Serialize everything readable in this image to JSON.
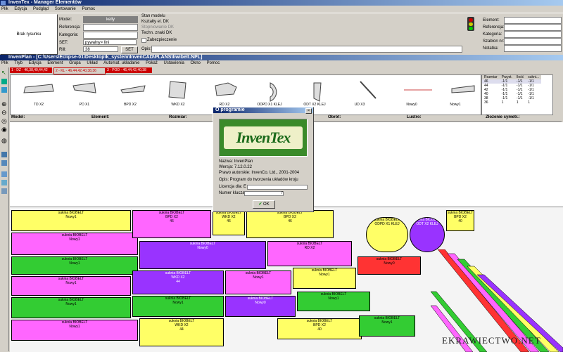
{
  "manager": {
    "title": "InvenTex - Manager Elementów",
    "menu": [
      "Plik",
      "Edycja",
      "Podgląd",
      "Sortowanie",
      "Pomoc"
    ],
    "preview_button": "Brak rysunku",
    "labels": {
      "model": "Model:",
      "referencja": "Referencja:",
      "kategoria": "Kategoria:",
      "set": "SET:",
      "rill": "Rill:"
    },
    "model_value": "kelly",
    "set_value": "pywalny> lini",
    "rill_value": "38",
    "set_button": "SET",
    "stan_title": "Stan modelu",
    "stan_lines": [
      "Kształty el. DK",
      "Stopniowanie DK",
      "Techn. znaki DK"
    ],
    "zabezpieczenie": "Zabezpieczenie",
    "opis": "Opis:",
    "right_labels": [
      "Element:",
      "Referencja:",
      "Kategoria:",
      "Szablon nr:",
      "Notatka:"
    ]
  },
  "plan": {
    "title": "InvenPlan - [C:\\Users\\Eclipse-01\\Desktop\\k_system\\InvenCAD\\PLANS\\liwibelt.NPL]",
    "menu": [
      "Plik",
      "Tryb",
      "Edycja",
      "Element",
      "Grupa",
      "Układ",
      "Automat. układanie",
      "Pokaż",
      "Ustawienia",
      "Okno",
      "Pomoc"
    ],
    "tabs": [
      "1 - DZ - 46,38,40,44,42",
      "2 - KL - 46,44,42,40,38,36",
      "3 - POD - 46,44,42,40,38"
    ],
    "shapes": [
      {
        "label": "TD X2"
      },
      {
        "label": "PD X1"
      },
      {
        "label": "BPD X2"
      },
      {
        "label": "WKD X2"
      },
      {
        "label": "RD X2"
      },
      {
        "label": "ODPD X1 KLEJ"
      },
      {
        "label": "ODT X2 KLEJ"
      },
      {
        "label": "UD X3"
      },
      {
        "label": "Nowy0"
      },
      {
        "label": "Nowy1"
      }
    ],
    "size_table": {
      "headers": [
        "Rozmiar",
        "Przyst.",
        "Ilość",
        "sukni..."
      ],
      "rows": [
        [
          "46",
          "-1/1",
          "-1/1",
          "-1/1"
        ],
        [
          "44",
          "-1/1",
          "-1/1",
          "-1/1"
        ],
        [
          "42",
          "-1/1",
          "-1/1",
          "-1/1"
        ],
        [
          "40",
          "-1/1",
          "-1/1",
          "-1/1"
        ],
        [
          "38",
          "-1/1",
          "-1/1",
          "-1/1"
        ],
        [
          "36",
          "1",
          "1",
          "1"
        ]
      ]
    },
    "columns": [
      "Model:",
      "Element:",
      "Rozmiar:",
      "Obrót:",
      "Lustro:",
      "Złożenie symetr.:"
    ],
    "pieces": [
      {
        "text": "suknia BIOBELT\nNowy1",
        "color": "#ffff66"
      },
      {
        "text": "suknia BIOBELT\nNowy1",
        "color": "#ff66ff"
      },
      {
        "text": "suknia BIOBELT\nBPD X2\n46",
        "color": "#ff66ff"
      },
      {
        "text": "suknia BIOBELT\nWKD X2\n46",
        "color": "#ffff66"
      },
      {
        "text": "suknia BIOBELT\nBPD X2\n46",
        "color": "#ffff66"
      },
      {
        "text": "suknia BIOBELT\nNowy1",
        "color": "#33cc33"
      },
      {
        "text": "suknia BIOBELT\nNowy0",
        "color": "#9933ff"
      },
      {
        "text": "suknia BIOBELT\nRD X2",
        "color": "#ff66ff"
      },
      {
        "text": "suknia BIOBELT\nNowy1",
        "color": "#ff66ff"
      },
      {
        "text": "suknia BIOBELT\nNowy1",
        "color": "#33cc33"
      },
      {
        "text": "suknia BIOBELT\nWKD X2\n44",
        "color": "#9933ff"
      },
      {
        "text": "suknia BIOBELT\nNowy1",
        "color": "#ff66ff"
      },
      {
        "text": "suknia BIOBELT\nNowy1",
        "color": "#ffff66"
      },
      {
        "text": "suknia BIOBELT\nNowy1",
        "color": "#ff66ff"
      },
      {
        "text": "suknia BIOBELT\nNowy1",
        "color": "#33cc33"
      },
      {
        "text": "suknia BIOBELT\nNowy0",
        "color": "#9933ff"
      },
      {
        "text": "suknia BIOBELT\nNowy1",
        "color": "#33cc33"
      },
      {
        "text": "suknia BIOBELT\nWKD X2\n44",
        "color": "#ffff66"
      },
      {
        "text": "suknia BIOBELT\nBPD X2\n40",
        "color": "#ffff66"
      },
      {
        "text": "suknia BIOBELT\nNowy1",
        "color": "#33cc33"
      },
      {
        "text": "suknia BIOBELT\nNowy0",
        "color": "#ff3333"
      },
      {
        "text": "suknia BIOBELT\nODPD X1 KLEJ",
        "color": "#ffff66"
      },
      {
        "text": "suknia BIOBELT\nODT X2 KLEJ",
        "color": "#9933ff"
      },
      {
        "text": "suknia BIOBELT\nBPD X2\n40",
        "color": "#ffff66"
      }
    ],
    "colors": {
      "yellow": "#ffff66",
      "magenta": "#ff66ff",
      "green": "#33cc33",
      "purple": "#9933ff",
      "red": "#ff3333"
    }
  },
  "about": {
    "title": "O programie",
    "logo": "InvenTex",
    "lines": [
      "Nazwa: InvenPlan",
      "Wersja: 7.12.0.22",
      "Prawo autorskie: InvenCo. Ltd., 2001-2004",
      "Opis: Program do tworzenia układów kroju",
      "Licencja dla: E",
      "Numer klucza:"
    ],
    "key_suffix": "7",
    "ok": "OK"
  },
  "watermark": "EKRAWIECTWO.NET"
}
